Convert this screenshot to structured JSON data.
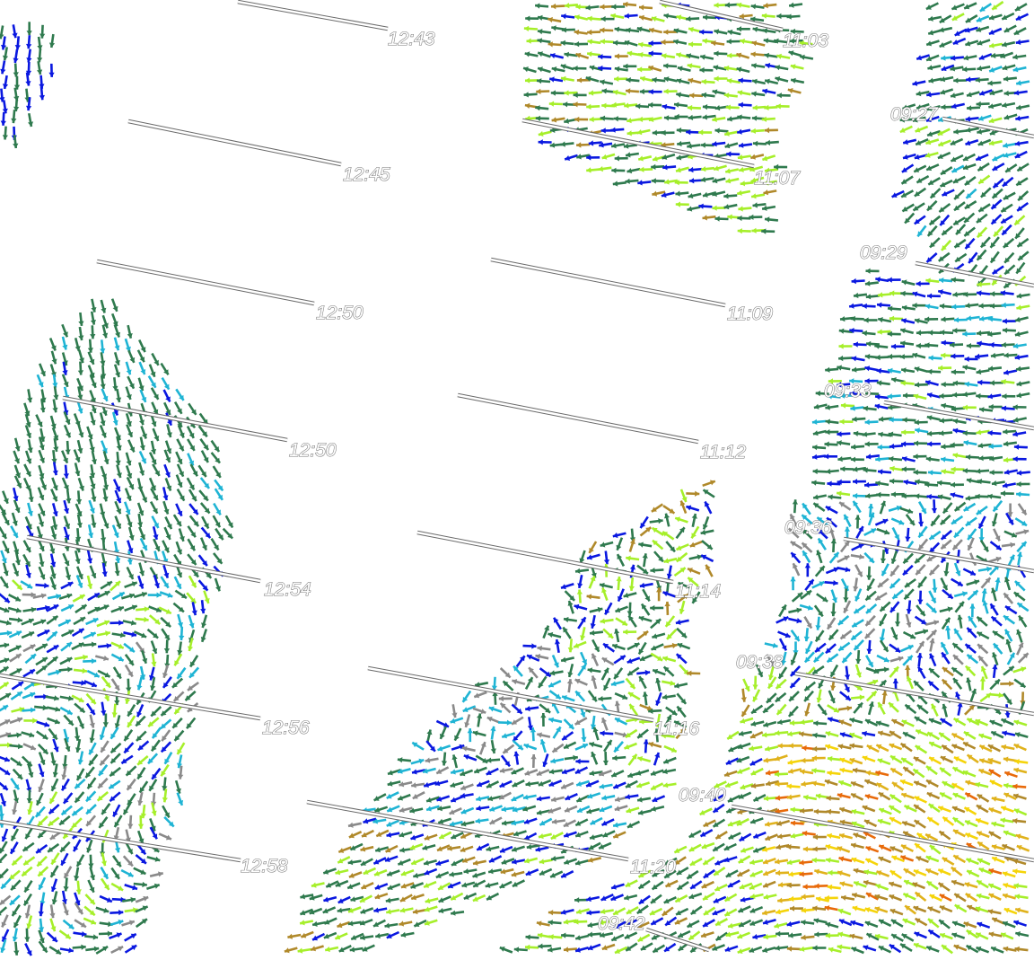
{
  "map": {
    "kind": "current-vector-field",
    "arrow_colors": [
      "#0a18e0",
      "#1fb4d4",
      "#2f7a4e",
      "#8a8a8a",
      "#a6ef2a",
      "#b0892a",
      "#e0b21c",
      "#f5d40a",
      "#e86a0a"
    ],
    "track_line_color": "#6a6a6a",
    "track_labels": [
      "12:43",
      "12:45",
      "12:50",
      "12:50",
      "12:54",
      "12:56",
      "12:58",
      "11:03",
      "11:07",
      "11:09",
      "11:12",
      "11:14",
      "11:16",
      "11:20",
      "09:27",
      "09:29",
      "09:33",
      "09:36",
      "09:38",
      "09:40",
      "09:42"
    ]
  }
}
